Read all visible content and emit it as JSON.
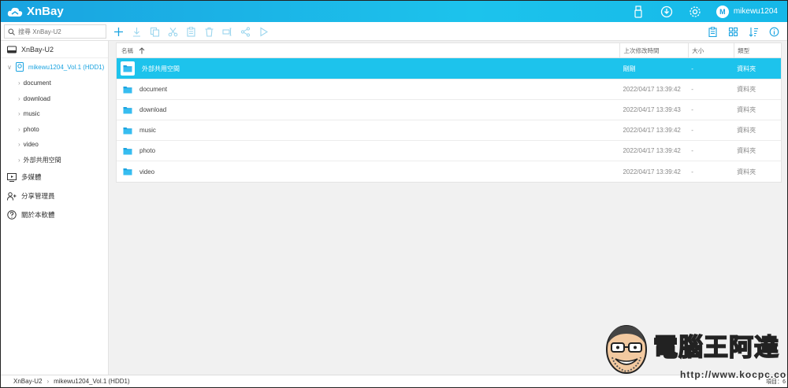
{
  "app": {
    "name": "XnBay"
  },
  "header": {
    "username": "mikewu1204",
    "avatar_letter": "M"
  },
  "search": {
    "placeholder": "搜尋 XnBay-U2"
  },
  "sidebar": {
    "root": "XnBay-U2",
    "volume": "mikewu1204_Vol.1 (HDD1)",
    "folders": [
      "document",
      "download",
      "music",
      "photo",
      "video",
      "外部共用空間"
    ],
    "items": [
      {
        "label": "多媒體",
        "icon": "media-icon"
      },
      {
        "label": "分享管理員",
        "icon": "share-users-icon"
      },
      {
        "label": "關於本軟體",
        "icon": "help-icon"
      }
    ]
  },
  "table": {
    "headers": {
      "name": "名稱",
      "modified": "上次修改時間",
      "size": "大小",
      "type": "類型"
    },
    "rows": [
      {
        "name": "外部共用空間",
        "modified": "剛剛",
        "size": "-",
        "type": "資料夾",
        "selected": true
      },
      {
        "name": "document",
        "modified": "2022/04/17 13:39:42",
        "size": "-",
        "type": "資料夾"
      },
      {
        "name": "download",
        "modified": "2022/04/17 13:39:43",
        "size": "-",
        "type": "資料夾"
      },
      {
        "name": "music",
        "modified": "2022/04/17 13:39:42",
        "size": "-",
        "type": "資料夾"
      },
      {
        "name": "photo",
        "modified": "2022/04/17 13:39:42",
        "size": "-",
        "type": "資料夾"
      },
      {
        "name": "video",
        "modified": "2022/04/17 13:39:42",
        "size": "-",
        "type": "資料夾"
      }
    ]
  },
  "statusbar": {
    "crumb_root": "XnBay-U2",
    "crumb_volume": "mikewu1204_Vol.1 (HDD1)",
    "item_count": "項目：6"
  },
  "watermark": {
    "title": "電腦王阿達",
    "url": "http://www.kocpc.com.tw"
  },
  "colors": {
    "accent": "#1dc3ec",
    "header": "#1aa3e0"
  }
}
